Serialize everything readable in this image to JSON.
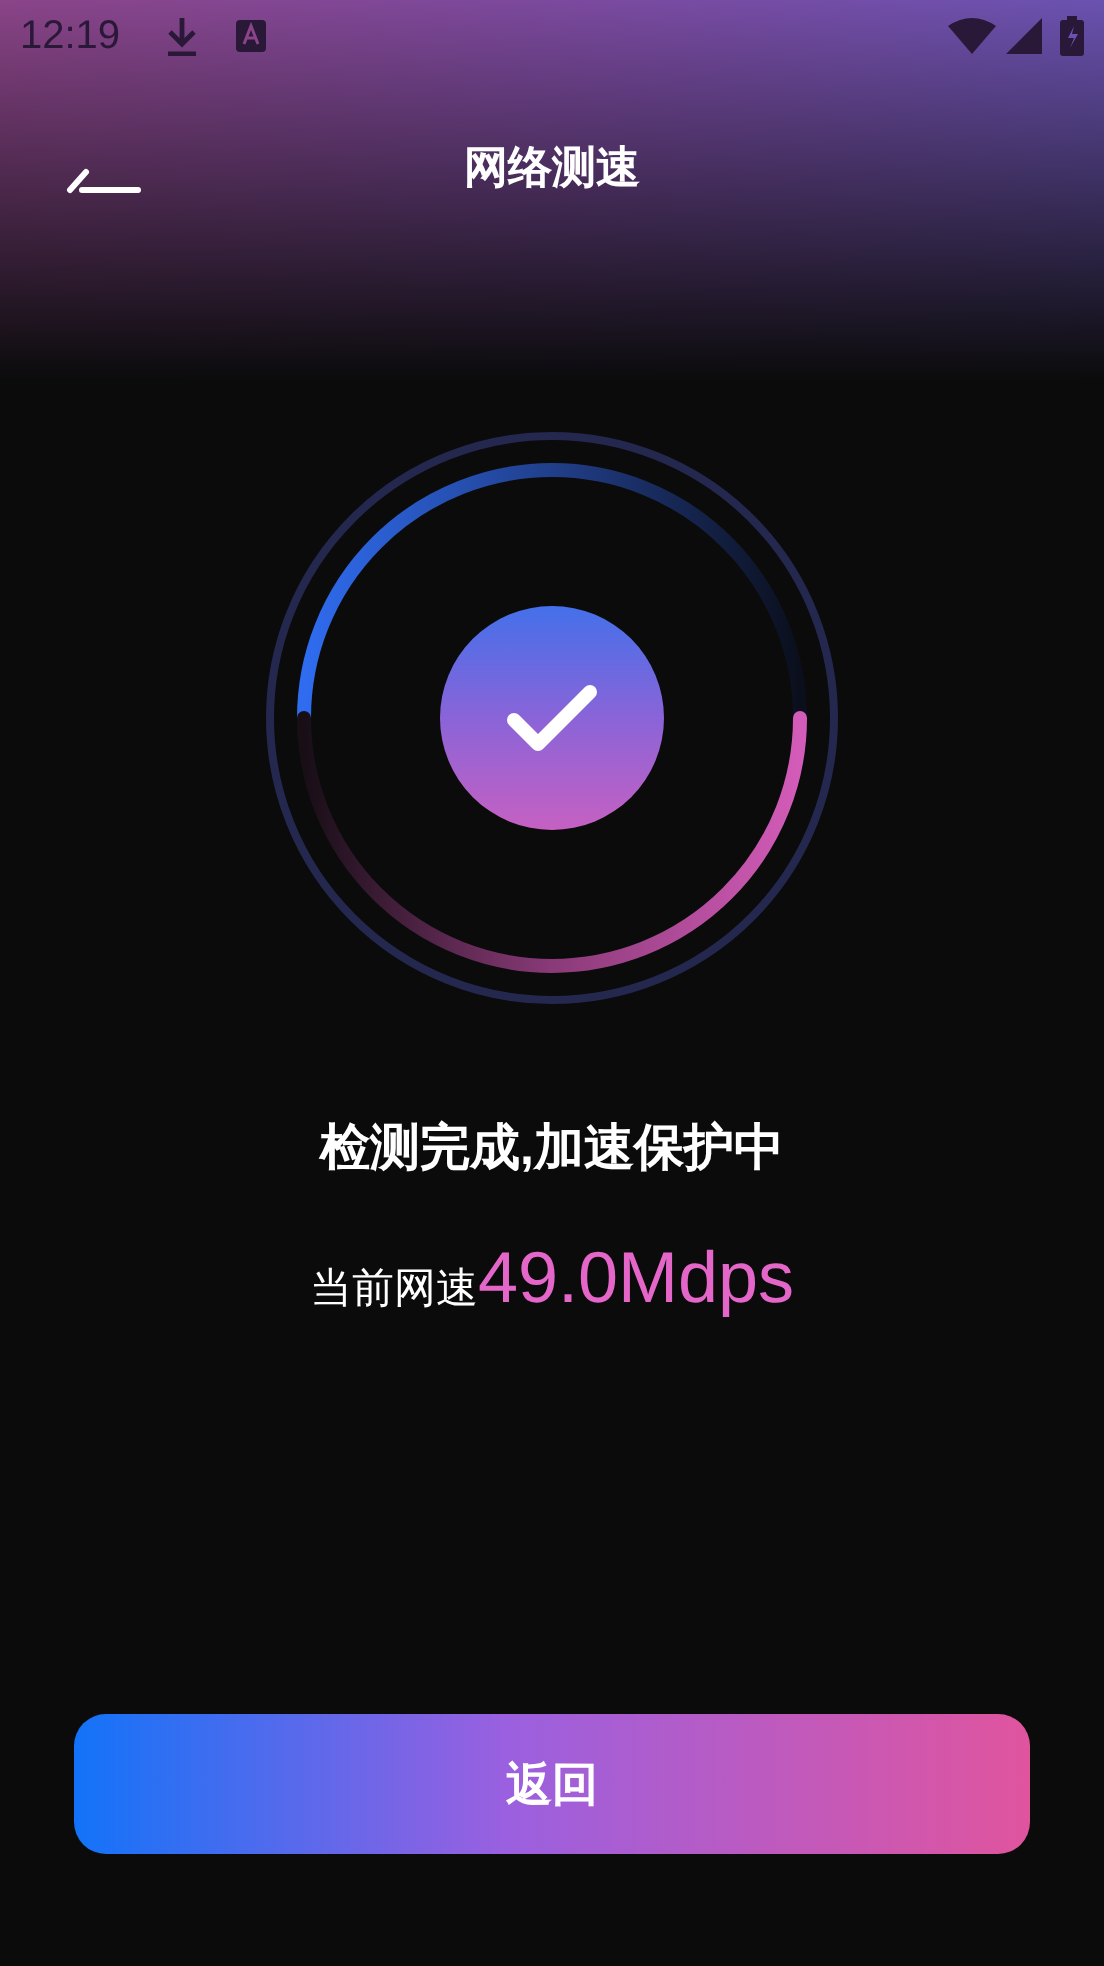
{
  "status_bar": {
    "time": "12:19"
  },
  "header": {
    "title": "网络测速"
  },
  "result": {
    "message": "检测完成,加速保护中",
    "speed_label": "当前网速",
    "speed_value": "49.0Mdps"
  },
  "button": {
    "label": "返回"
  }
}
